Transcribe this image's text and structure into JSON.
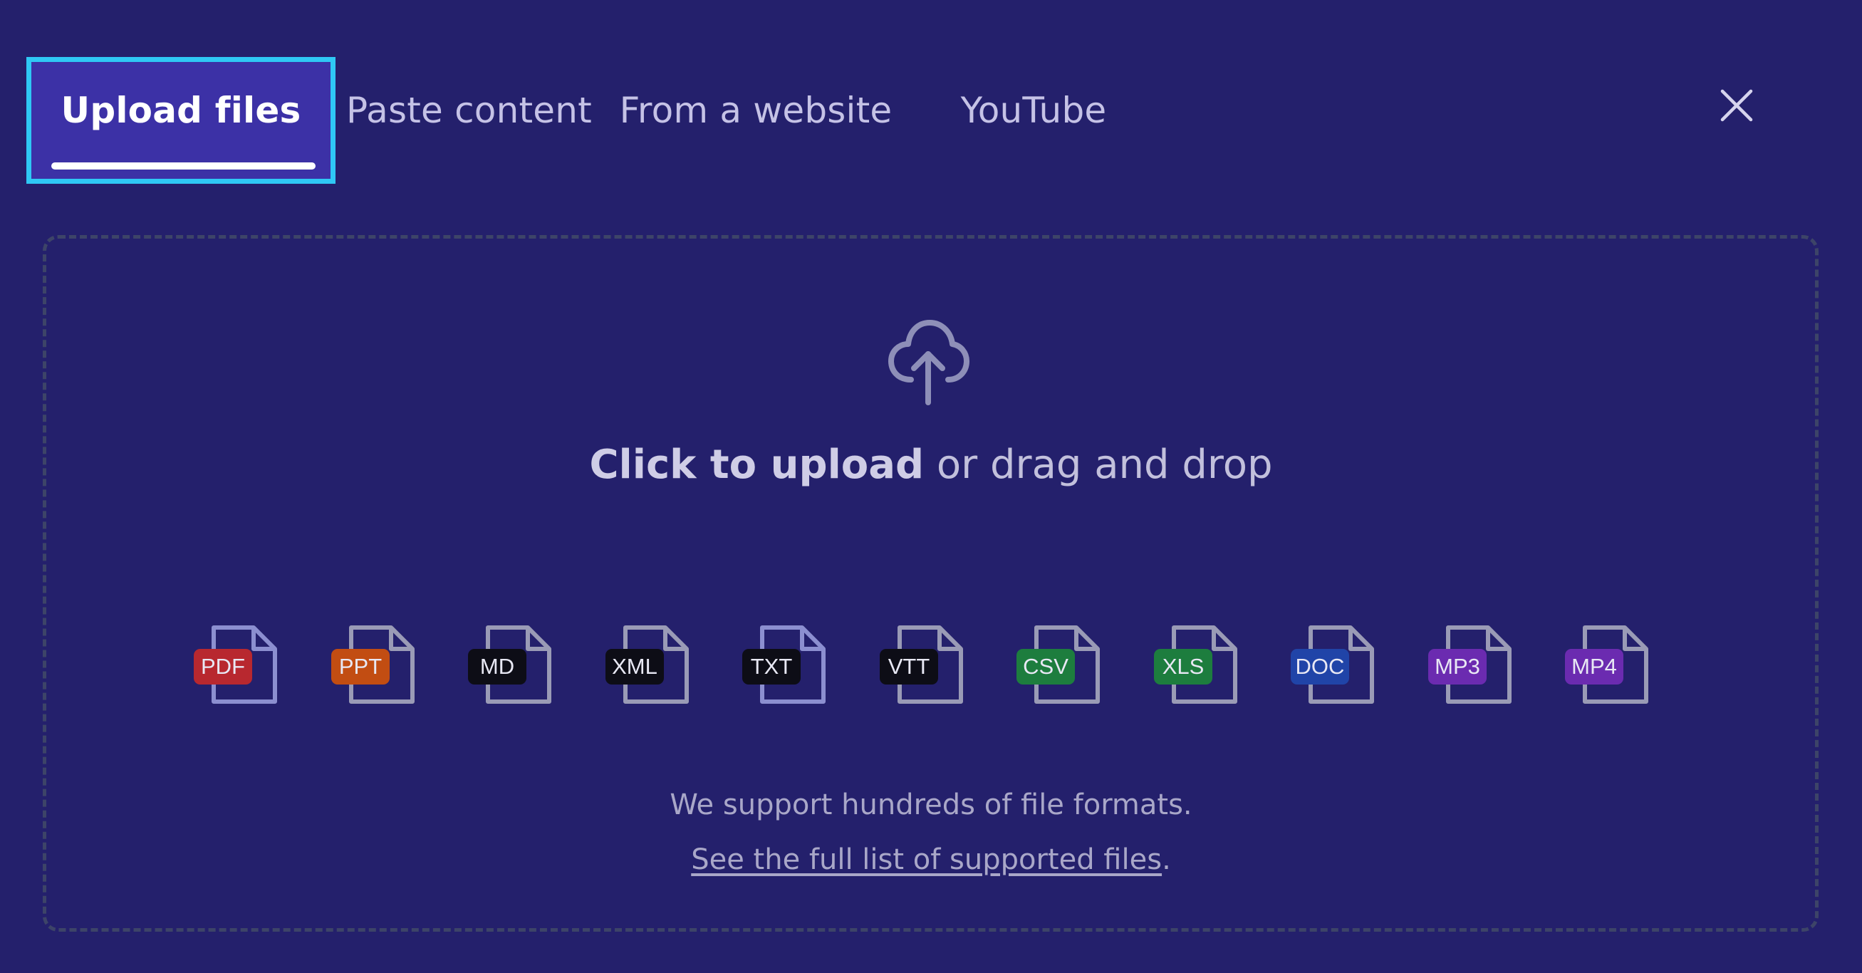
{
  "tabs": [
    {
      "label": "Upload files",
      "active": true
    },
    {
      "label": "Paste content",
      "active": false
    },
    {
      "label": "From a website",
      "active": false
    },
    {
      "label": "YouTube",
      "active": false
    }
  ],
  "close": {
    "icon": "close-icon"
  },
  "dropzone": {
    "icon": "cloud-upload-icon",
    "headline_strong": "Click to upload",
    "headline_rest": " or drag and drop",
    "file_types": [
      {
        "label": "PDF",
        "color": "#b8282f"
      },
      {
        "label": "PPT",
        "color": "#c24d12"
      },
      {
        "label": "MD",
        "color": "#0d0d16"
      },
      {
        "label": "XML",
        "color": "#0d0d16"
      },
      {
        "label": "TXT",
        "color": "#0d0d16"
      },
      {
        "label": "VTT",
        "color": "#0d0d16"
      },
      {
        "label": "CSV",
        "color": "#1d7d3e"
      },
      {
        "label": "XLS",
        "color": "#1d7d3e"
      },
      {
        "label": "DOC",
        "color": "#2044a8"
      },
      {
        "label": "MP3",
        "color": "#6b2bb0"
      },
      {
        "label": "MP4",
        "color": "#6b2bb0"
      }
    ],
    "support_text": "We support hundreds of file formats.",
    "support_link": "See the full list of supported files",
    "support_link_suffix": "."
  },
  "colors": {
    "background": "#24206c",
    "active_tab": "#3c31a6",
    "focus_ring": "#2fc8f5"
  }
}
